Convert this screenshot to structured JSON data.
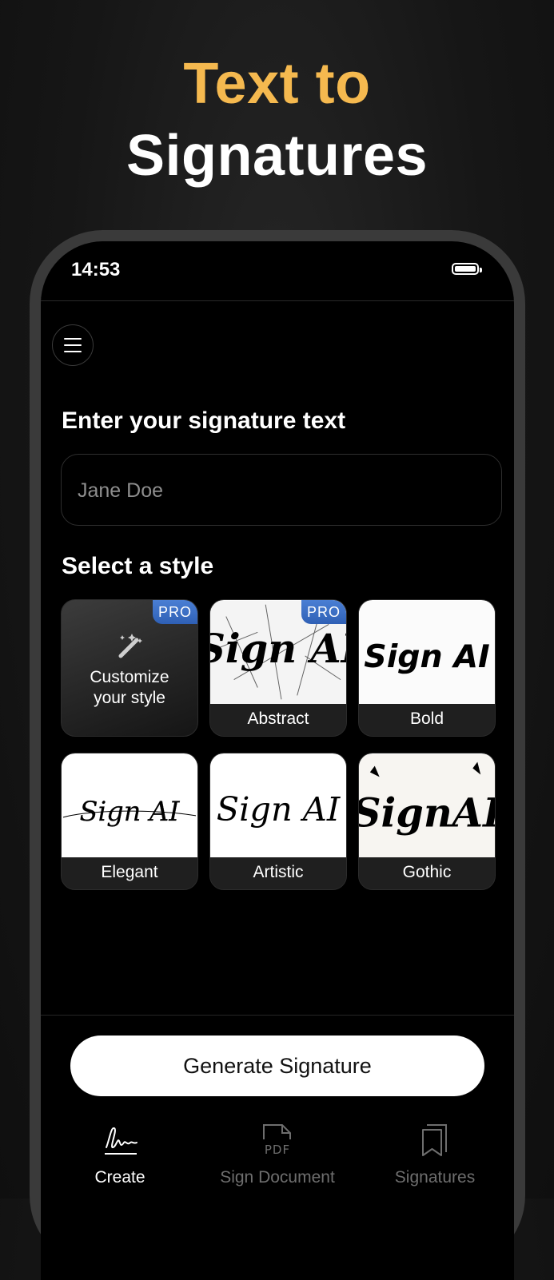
{
  "headline": {
    "line1": "Text to",
    "line2": "Signatures"
  },
  "status_bar": {
    "time": "14:53"
  },
  "form": {
    "signature_title": "Enter your signature text",
    "signature_placeholder": "Jane Doe",
    "style_title": "Select a style"
  },
  "styles": [
    {
      "label": "Customize your style",
      "pro": true
    },
    {
      "label": "Abstract",
      "pro": true,
      "preview_text": "Sign AI"
    },
    {
      "label": "Bold",
      "pro": false,
      "preview_text": "Sign AI"
    },
    {
      "label": "Elegant",
      "pro": false,
      "preview_text": "Sign AI"
    },
    {
      "label": "Artistic",
      "pro": false,
      "preview_text": "Sign AI"
    },
    {
      "label": "Gothic",
      "pro": false,
      "preview_text": "SignAI"
    }
  ],
  "pro_badge": "PRO",
  "generate_button": "Generate Signature",
  "tabs": [
    {
      "label": "Create",
      "icon": "signature-icon",
      "active": true
    },
    {
      "label": "Sign Document",
      "icon": "pdf-document-icon",
      "active": false,
      "icon_text": "PDF"
    },
    {
      "label": "Signatures",
      "icon": "bookmark-stack-icon",
      "active": false
    }
  ],
  "colors": {
    "accent": "#f5b94f",
    "pro_badge": "#3a6cc2",
    "background": "#161616",
    "screen": "#000000"
  }
}
